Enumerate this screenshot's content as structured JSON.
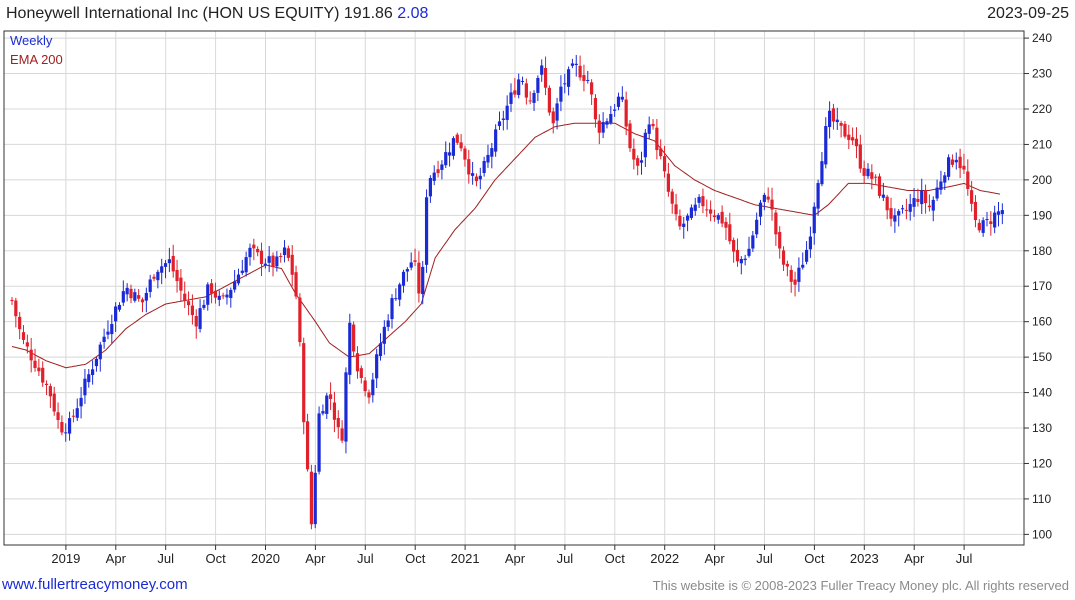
{
  "header": {
    "title": "Honeywell International Inc (HON US EQUITY) 191.86",
    "change": "2.08",
    "date": "2023-09-25"
  },
  "footer": {
    "website": "www.fullertreacymoney.com",
    "copyright": "This website is © 2008-2023 Fuller Treacy Money plc. All rights reserved"
  },
  "colors": {
    "up": "#1a2bd6",
    "down": "#e0202a",
    "ema": "#a02020",
    "grid": "#d8d8d8",
    "frame": "#333333"
  },
  "chart_data": {
    "type": "candlestick",
    "frequency": "Weekly",
    "legend": [
      "Weekly",
      "EMA 200"
    ],
    "ylim": [
      97,
      242
    ],
    "yticks": [
      100,
      110,
      120,
      130,
      140,
      150,
      160,
      170,
      180,
      190,
      200,
      210,
      220,
      230,
      240
    ],
    "xticks": [
      {
        "label": "2019",
        "t": 2019.0
      },
      {
        "label": "Apr",
        "t": 2019.25
      },
      {
        "label": "Jul",
        "t": 2019.5
      },
      {
        "label": "Oct",
        "t": 2019.75
      },
      {
        "label": "2020",
        "t": 2020.0
      },
      {
        "label": "Apr",
        "t": 2020.25
      },
      {
        "label": "Jul",
        "t": 2020.5
      },
      {
        "label": "Oct",
        "t": 2020.75
      },
      {
        "label": "2021",
        "t": 2021.0
      },
      {
        "label": "Apr",
        "t": 2021.25
      },
      {
        "label": "Jul",
        "t": 2021.5
      },
      {
        "label": "Oct",
        "t": 2021.75
      },
      {
        "label": "2022",
        "t": 2022.0
      },
      {
        "label": "Apr",
        "t": 2022.25
      },
      {
        "label": "Jul",
        "t": 2022.5
      },
      {
        "label": "Oct",
        "t": 2022.75
      },
      {
        "label": "2023",
        "t": 2023.0
      },
      {
        "label": "Apr",
        "t": 2023.25
      },
      {
        "label": "Jul",
        "t": 2023.5
      }
    ],
    "trange": [
      2018.72,
      2023.77
    ],
    "close_anchors": [
      [
        2018.73,
        166
      ],
      [
        2018.78,
        155
      ],
      [
        2018.85,
        148
      ],
      [
        2018.92,
        140
      ],
      [
        2018.97,
        130
      ],
      [
        2019.02,
        131
      ],
      [
        2019.08,
        140
      ],
      [
        2019.15,
        150
      ],
      [
        2019.22,
        160
      ],
      [
        2019.3,
        170
      ],
      [
        2019.38,
        165
      ],
      [
        2019.45,
        175
      ],
      [
        2019.52,
        177
      ],
      [
        2019.58,
        168
      ],
      [
        2019.65,
        160
      ],
      [
        2019.72,
        170
      ],
      [
        2019.78,
        165
      ],
      [
        2019.85,
        172
      ],
      [
        2019.92,
        180
      ],
      [
        2019.97,
        178
      ],
      [
        2020.05,
        176
      ],
      [
        2020.1,
        180
      ],
      [
        2020.13,
        175
      ],
      [
        2020.16,
        165
      ],
      [
        2020.2,
        125
      ],
      [
        2020.23,
        103
      ],
      [
        2020.27,
        135
      ],
      [
        2020.32,
        140
      ],
      [
        2020.38,
        125
      ],
      [
        2020.42,
        160
      ],
      [
        2020.47,
        145
      ],
      [
        2020.52,
        140
      ],
      [
        2020.58,
        155
      ],
      [
        2020.63,
        165
      ],
      [
        2020.68,
        172
      ],
      [
        2020.74,
        178
      ],
      [
        2020.78,
        165
      ],
      [
        2020.81,
        200
      ],
      [
        2020.88,
        205
      ],
      [
        2020.95,
        212
      ],
      [
        2020.98,
        210
      ],
      [
        2021.05,
        198
      ],
      [
        2021.1,
        204
      ],
      [
        2021.15,
        212
      ],
      [
        2021.22,
        222
      ],
      [
        2021.28,
        230
      ],
      [
        2021.32,
        222
      ],
      [
        2021.38,
        232
      ],
      [
        2021.44,
        215
      ],
      [
        2021.48,
        226
      ],
      [
        2021.55,
        232
      ],
      [
        2021.62,
        228
      ],
      [
        2021.66,
        214
      ],
      [
        2021.72,
        218
      ],
      [
        2021.78,
        224
      ],
      [
        2021.83,
        208
      ],
      [
        2021.87,
        202
      ],
      [
        2021.92,
        218
      ],
      [
        2021.97,
        208
      ],
      [
        2022.02,
        196
      ],
      [
        2022.07,
        186
      ],
      [
        2022.13,
        190
      ],
      [
        2022.18,
        194
      ],
      [
        2022.24,
        191
      ],
      [
        2022.3,
        188
      ],
      [
        2022.36,
        176
      ],
      [
        2022.42,
        180
      ],
      [
        2022.48,
        193
      ],
      [
        2022.52,
        196
      ],
      [
        2022.58,
        178
      ],
      [
        2022.65,
        170
      ],
      [
        2022.72,
        182
      ],
      [
        2022.76,
        198
      ],
      [
        2022.82,
        218
      ],
      [
        2022.88,
        214
      ],
      [
        2022.94,
        212
      ],
      [
        2022.99,
        203
      ],
      [
        2023.05,
        200
      ],
      [
        2023.1,
        194
      ],
      [
        2023.15,
        188
      ],
      [
        2023.22,
        192
      ],
      [
        2023.28,
        196
      ],
      [
        2023.33,
        192
      ],
      [
        2023.4,
        203
      ],
      [
        2023.46,
        207
      ],
      [
        2023.5,
        202
      ],
      [
        2023.55,
        188
      ],
      [
        2023.6,
        187
      ],
      [
        2023.65,
        190
      ],
      [
        2023.7,
        191.86
      ]
    ],
    "ema_anchors": [
      [
        2018.73,
        153
      ],
      [
        2018.8,
        152
      ],
      [
        2018.9,
        149
      ],
      [
        2019.0,
        147
      ],
      [
        2019.1,
        148
      ],
      [
        2019.2,
        152
      ],
      [
        2019.3,
        158
      ],
      [
        2019.4,
        162
      ],
      [
        2019.5,
        165
      ],
      [
        2019.6,
        166
      ],
      [
        2019.7,
        167
      ],
      [
        2019.8,
        170
      ],
      [
        2019.9,
        173
      ],
      [
        2020.0,
        176
      ],
      [
        2020.08,
        175
      ],
      [
        2020.15,
        168
      ],
      [
        2020.25,
        160
      ],
      [
        2020.32,
        154
      ],
      [
        2020.42,
        150
      ],
      [
        2020.52,
        151
      ],
      [
        2020.6,
        155
      ],
      [
        2020.7,
        160
      ],
      [
        2020.78,
        165
      ],
      [
        2020.85,
        178
      ],
      [
        2020.95,
        186
      ],
      [
        2021.05,
        192
      ],
      [
        2021.15,
        200
      ],
      [
        2021.25,
        206
      ],
      [
        2021.35,
        212
      ],
      [
        2021.45,
        215
      ],
      [
        2021.55,
        216
      ],
      [
        2021.65,
        216
      ],
      [
        2021.75,
        216
      ],
      [
        2021.85,
        213
      ],
      [
        2021.95,
        211
      ],
      [
        2022.05,
        204
      ],
      [
        2022.15,
        200
      ],
      [
        2022.25,
        197
      ],
      [
        2022.35,
        195
      ],
      [
        2022.45,
        193
      ],
      [
        2022.55,
        192
      ],
      [
        2022.65,
        191
      ],
      [
        2022.75,
        190
      ],
      [
        2022.82,
        193
      ],
      [
        2022.92,
        199
      ],
      [
        2023.02,
        199
      ],
      [
        2023.12,
        198
      ],
      [
        2023.22,
        197
      ],
      [
        2023.32,
        197
      ],
      [
        2023.42,
        198
      ],
      [
        2023.5,
        199
      ],
      [
        2023.58,
        197
      ],
      [
        2023.68,
        196
      ]
    ]
  }
}
